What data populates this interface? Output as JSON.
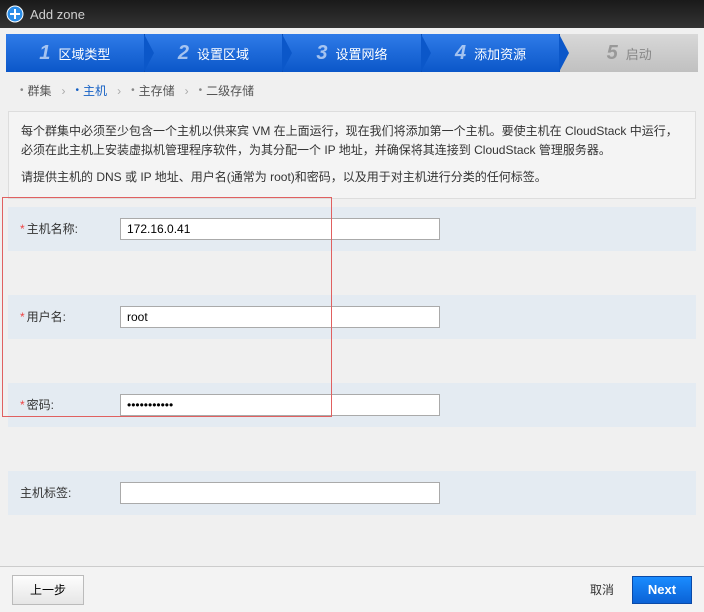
{
  "titlebar": {
    "title": "Add zone"
  },
  "steps": {
    "s1": {
      "num": "1",
      "label": "区域类型"
    },
    "s2": {
      "num": "2",
      "label": "设置区域"
    },
    "s3": {
      "num": "3",
      "label": "设置网络"
    },
    "s4": {
      "num": "4",
      "label": "添加资源"
    },
    "s5": {
      "num": "5",
      "label": "启动"
    }
  },
  "subnav": {
    "cluster": "群集",
    "host": "主机",
    "primary": "主存储",
    "secondary": "二级存储"
  },
  "desc": {
    "p1": "每个群集中必须至少包含一个主机以供来宾 VM 在上面运行，现在我们将添加第一个主机。要使主机在 CloudStack 中运行，必须在此主机上安装虚拟机管理程序软件，为其分配一个 IP 地址，并确保将其连接到 CloudStack 管理服务器。",
    "p2": "请提供主机的 DNS 或 IP 地址、用户名(通常为 root)和密码，以及用于对主机进行分类的任何标签。"
  },
  "form": {
    "hostname_label": "主机名称:",
    "hostname_value": "172.16.0.41",
    "username_label": "用户名:",
    "username_value": "root",
    "password_label": "密码:",
    "password_value": "•••••••••••",
    "tags_label": "主机标签:",
    "tags_value": ""
  },
  "footer": {
    "prev": "上一步",
    "cancel": "取消",
    "next": "Next"
  }
}
